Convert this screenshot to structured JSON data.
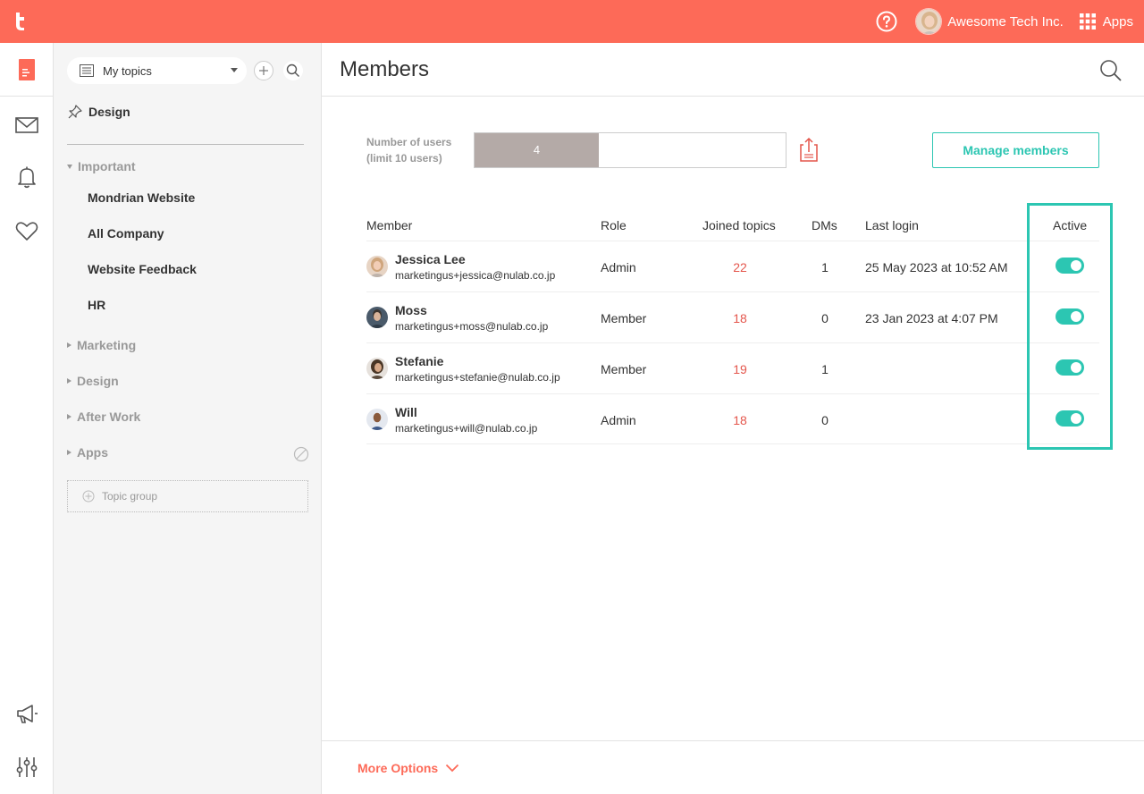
{
  "topbar": {
    "org_name": "Awesome Tech Inc.",
    "apps_label": "Apps",
    "brand_color": "#fd6a58"
  },
  "sidebar": {
    "topic_filter": "My topics",
    "pinned": "Design",
    "groups": [
      {
        "label": "Important",
        "expanded": true,
        "topics": [
          "Mondrian Website",
          "All Company",
          "Website Feedback",
          "HR"
        ]
      },
      {
        "label": "Marketing",
        "expanded": false
      },
      {
        "label": "Design",
        "expanded": false
      },
      {
        "label": "After Work",
        "expanded": false
      },
      {
        "label": "Apps",
        "expanded": false
      }
    ],
    "topic_group_label": "Topic group"
  },
  "main": {
    "title": "Members",
    "users_label_line1": "Number of users",
    "users_label_line2": "(limit 10 users)",
    "users_count": "4",
    "users_fraction": 0.4,
    "manage_label": "Manage members",
    "accent_color": "#2cc6b2",
    "columns": {
      "member": "Member",
      "role": "Role",
      "topics": "Joined topics",
      "dms": "DMs",
      "last_login": "Last login",
      "active": "Active"
    },
    "members": [
      {
        "name": "Jessica Lee",
        "email": "marketingus+jessica@nulab.co.jp",
        "role": "Admin",
        "topics": "22",
        "dms": "1",
        "last_login": "25 May 2023 at 10:52 AM",
        "active": true
      },
      {
        "name": "Moss",
        "email": "marketingus+moss@nulab.co.jp",
        "role": "Member",
        "topics": "18",
        "dms": "0",
        "last_login": "23 Jan 2023 at 4:07 PM",
        "active": true
      },
      {
        "name": "Stefanie",
        "email": "marketingus+stefanie@nulab.co.jp",
        "role": "Member",
        "topics": "19",
        "dms": "1",
        "last_login": "",
        "active": true
      },
      {
        "name": "Will",
        "email": "marketingus+will@nulab.co.jp",
        "role": "Admin",
        "topics": "18",
        "dms": "0",
        "last_login": "",
        "active": true
      }
    ],
    "more_options": "More Options"
  }
}
